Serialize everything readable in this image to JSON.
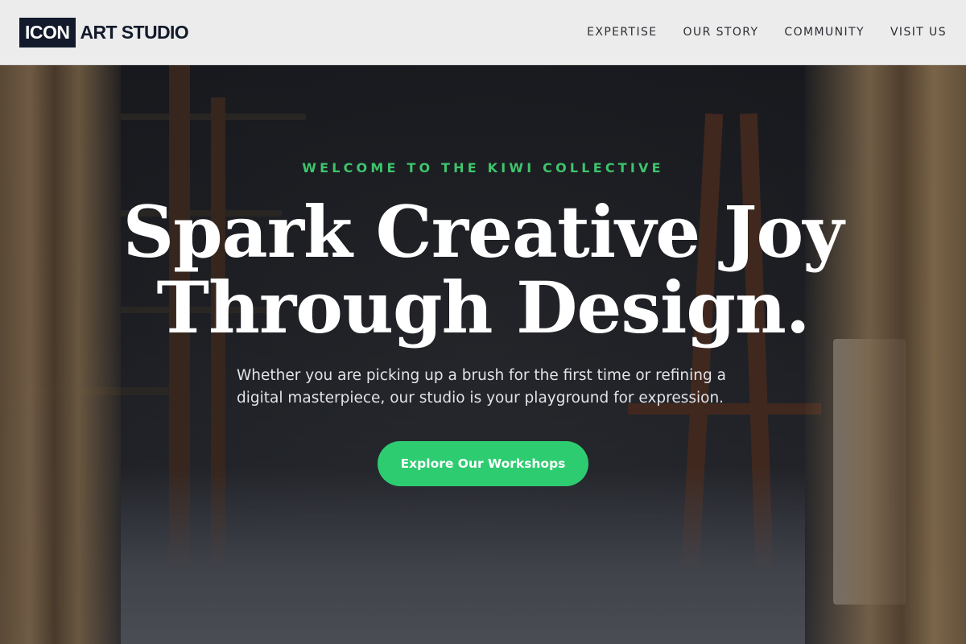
{
  "header": {
    "logo_box": "ICON",
    "logo_text": "ART STUDIO",
    "nav": [
      {
        "label": "EXPERTISE"
      },
      {
        "label": "OUR STORY"
      },
      {
        "label": "COMMUNITY"
      },
      {
        "label": "VISIT US"
      }
    ]
  },
  "hero": {
    "eyebrow": "WELCOME TO THE KIWI COLLECTIVE",
    "headline_line1": "Spark Creative Joy",
    "headline_line2": "Through Design.",
    "subtext": "Whether you are picking up a brush for the first time or refining a digital masterpiece, our studio is your playground for expression.",
    "cta_label": "Explore Our Workshops",
    "background": "art-studio-photo"
  },
  "colors": {
    "accent": "#2ecc71",
    "eyebrow": "#3ec46d",
    "logo_dark": "#121a2b",
    "header_bg": "#ececec"
  }
}
